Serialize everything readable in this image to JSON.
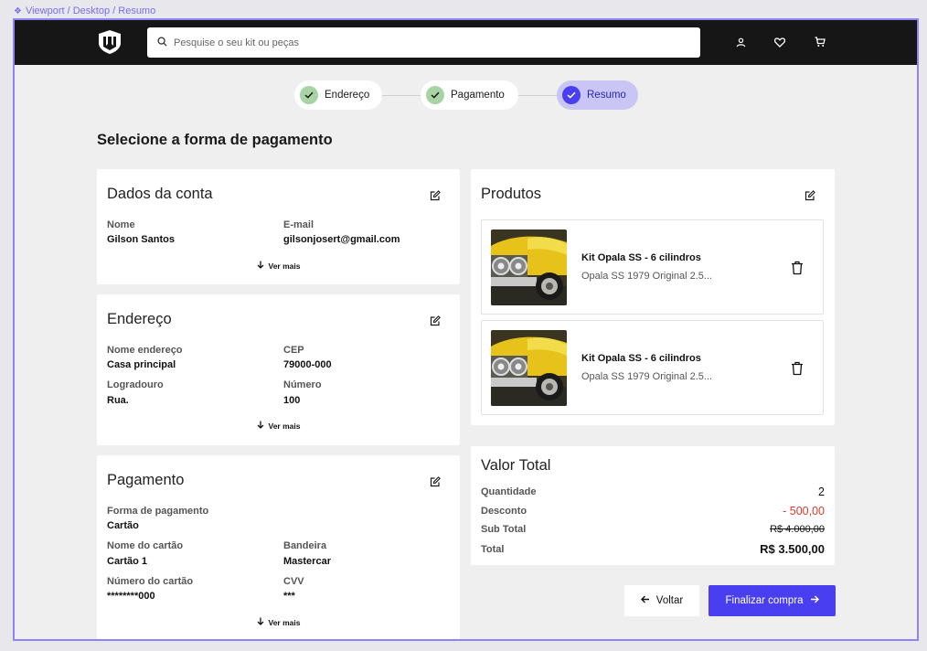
{
  "frame_label": "Viewport / Desktop  / Resumo",
  "header": {
    "search_placeholder": "Pesquise o seu kit ou peças",
    "icons": [
      "user-icon",
      "heart-icon",
      "cart-icon"
    ]
  },
  "stepper": {
    "steps": [
      {
        "label": "Endereço",
        "state": "done"
      },
      {
        "label": "Pagamento",
        "state": "done"
      },
      {
        "label": "Resumo",
        "state": "active"
      }
    ]
  },
  "page_title": "Selecione a forma de pagamento",
  "conta": {
    "title": "Dados da conta",
    "nome_label": "Nome",
    "nome_value": "Gilson Santos",
    "email_label": "E-mail",
    "email_value": "gilsonjosert@gmail.com",
    "ver_mais": "Ver mais"
  },
  "endereco": {
    "title": "Endereço",
    "nome_label": "Nome endereço",
    "nome_value": "Casa principal",
    "cep_label": "CEP",
    "cep_value": "79000-000",
    "logradouro_label": "Logradouro",
    "logradouro_value": "Rua.",
    "numero_label": "Número",
    "numero_value": "100",
    "ver_mais": "Ver mais"
  },
  "pagamento": {
    "title": "Pagamento",
    "forma_label": "Forma de pagamento",
    "forma_value": "Cartão",
    "nome_cartao_label": "Nome do cartão",
    "nome_cartao_value": "Cartão 1",
    "bandeira_label": "Bandeira",
    "bandeira_value": "Mastercar",
    "numero_label": "Número do cartão",
    "numero_value": "********000",
    "cvv_label": "CVV",
    "cvv_value": "***",
    "ver_mais": "Ver mais"
  },
  "produtos": {
    "title": "Produtos",
    "items": [
      {
        "name": "Kit Opala SS - 6 cilindros",
        "desc": "Opala SS 1979 Original 2.5..."
      },
      {
        "name": "Kit Opala SS - 6 cilindros",
        "desc": "Opala SS 1979 Original 2.5..."
      }
    ]
  },
  "total": {
    "title": "Valor Total",
    "quantidade_label": "Quantidade",
    "quantidade_value": "2",
    "desconto_label": "Desconto",
    "desconto_value": "- 500,00",
    "subtotal_label": "Sub Total",
    "subtotal_value": "R$ 4.000,00",
    "total_label": "Total",
    "total_value": "R$ 3.500,00"
  },
  "actions": {
    "back_label": "Voltar",
    "finish_label": "Finalizar compra"
  },
  "colors": {
    "accent": "#4a3ff0",
    "step_done": "#a8d3a5",
    "discount": "#e0392d"
  }
}
